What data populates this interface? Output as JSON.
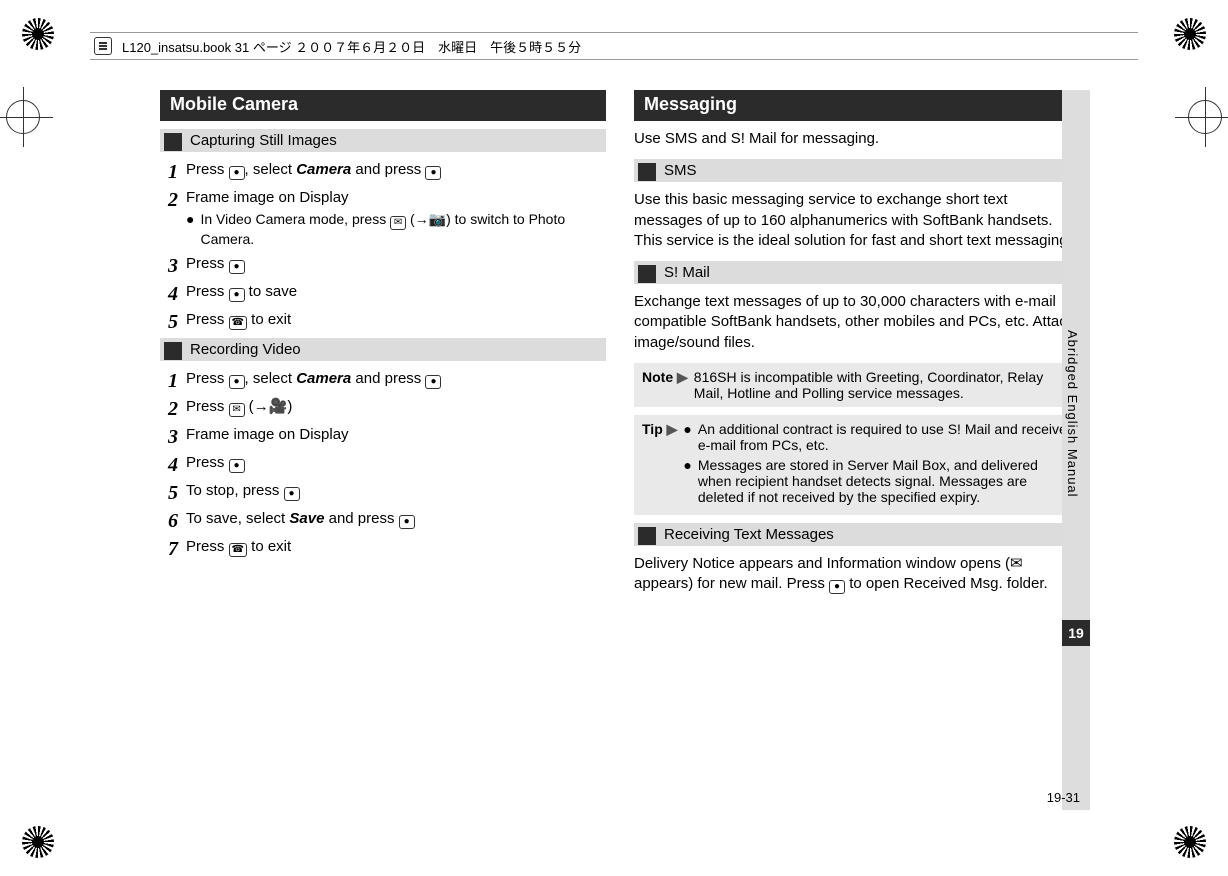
{
  "header": {
    "filename_text": "L120_insatsu.book 31 ページ ２００７年６月２０日　水曜日　午後５時５５分"
  },
  "side": {
    "label": "Abridged English Manual",
    "chapter": "19",
    "page_number": "19-31"
  },
  "left": {
    "title": "Mobile Camera",
    "sub1": "Capturing Still Images",
    "steps1": {
      "s1_a": "Press ",
      "s1_b": ", select ",
      "s1_camera": "Camera",
      "s1_c": " and press ",
      "s2": "Frame image on Display",
      "s2_note_a": "In Video Camera mode, press ",
      "s2_note_b": " (",
      "s2_note_c": ") to switch to Photo Camera.",
      "s3": "Press ",
      "s4": "Press ",
      "s4_b": " to save",
      "s5": "Press ",
      "s5_b": " to exit"
    },
    "sub2": "Recording Video",
    "steps2": {
      "s1_a": "Press ",
      "s1_b": ", select ",
      "s1_camera": "Camera",
      "s1_c": " and press ",
      "s2_a": "Press ",
      "s2_b": " (",
      "s2_c": ")",
      "s3": "Frame image on Display",
      "s4": "Press ",
      "s5": "To stop, press ",
      "s6_a": "To save, select ",
      "s6_save": "Save",
      "s6_b": " and press ",
      "s7": "Press ",
      "s7_b": " to exit"
    }
  },
  "right": {
    "title": "Messaging",
    "intro": "Use SMS and S! Mail for messaging.",
    "sub1": "SMS",
    "sms_body": "Use this basic messaging service to exchange short text messages of up to 160 alphanumerics with SoftBank handsets. This service is the ideal solution for fast and short text messaging!",
    "sub2": "S! Mail",
    "smail_body": "Exchange text messages of up to 30,000 characters with e-mail compatible SoftBank handsets, other mobiles and PCs, etc. Attach image/sound files.",
    "note_label": "Note",
    "note_body": "816SH is incompatible with Greeting, Coordinator, Relay Mail, Hotline and Polling service messages.",
    "tip_label": "Tip",
    "tip_item1": "An additional contract is required to use S! Mail and receive e-mail from PCs, etc.",
    "tip_item2": "Messages are stored in Server Mail Box, and delivered when recipient handset detects signal. Messages are deleted if not received by the specified expiry.",
    "sub3": "Receiving Text Messages",
    "recv_a": "Delivery Notice appears and Information window opens (",
    "recv_b": " appears) for new mail. Press ",
    "recv_c": " to open Received Msg. folder."
  },
  "buttons": {
    "center_dot": "●",
    "mail": "✉",
    "photo_mode": "→📷",
    "video_mode": "→🎥",
    "end": "☎",
    "envelope": "✉"
  }
}
